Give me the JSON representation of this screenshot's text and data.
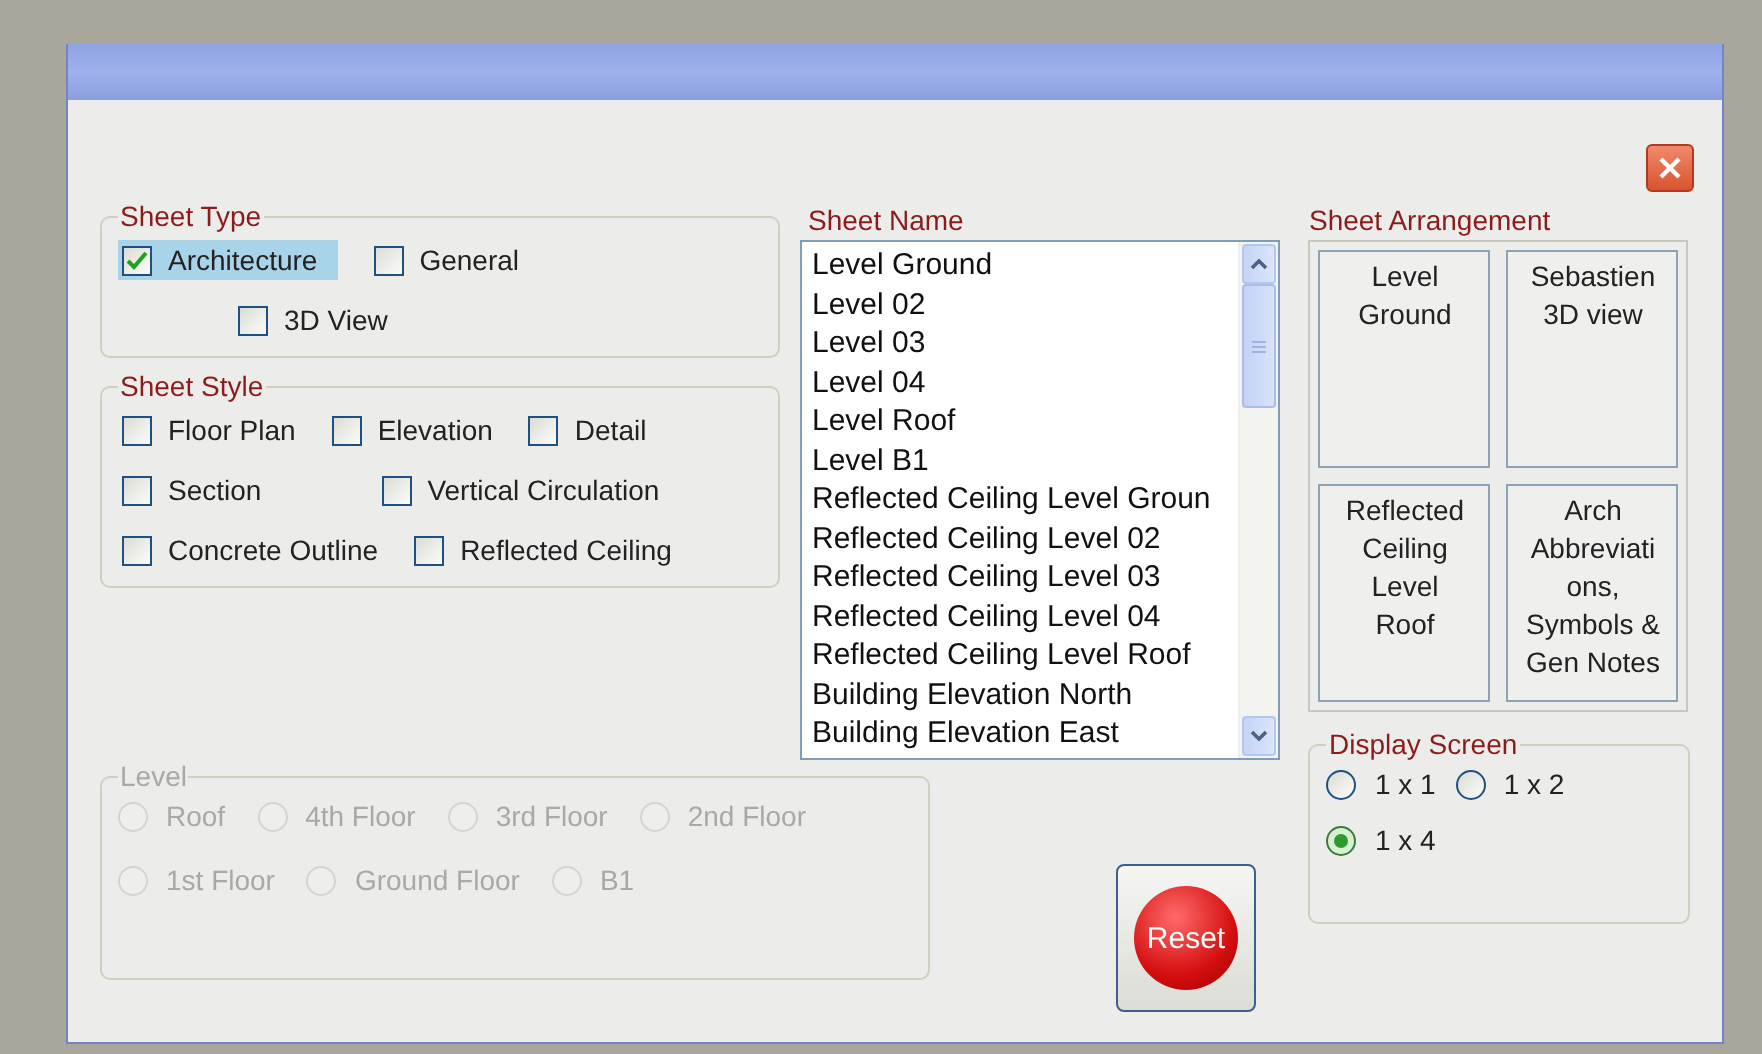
{
  "sheet_type": {
    "title": "Sheet Type",
    "options": [
      {
        "label": "Architecture",
        "checked": true,
        "focused": true
      },
      {
        "label": "General",
        "checked": false,
        "focused": false
      },
      {
        "label": "3D View",
        "checked": false,
        "focused": false
      }
    ]
  },
  "sheet_style": {
    "title": "Sheet Style",
    "options": [
      {
        "label": "Floor Plan",
        "checked": false
      },
      {
        "label": "Elevation",
        "checked": false
      },
      {
        "label": "Detail",
        "checked": false
      },
      {
        "label": "Section",
        "checked": false
      },
      {
        "label": "Vertical Circulation",
        "checked": false
      },
      {
        "label": "Concrete Outline",
        "checked": false
      },
      {
        "label": "Reflected Ceiling",
        "checked": false
      }
    ]
  },
  "sheet_name": {
    "title": "Sheet Name",
    "items": [
      "Level Ground",
      "Level 02",
      "Level 03",
      "Level 04",
      "Level Roof",
      "Level B1",
      "Reflected Ceiling Level Groun",
      "Reflected Ceiling Level 02",
      "Reflected Ceiling Level 03",
      "Reflected Ceiling Level 04",
      "Reflected Ceiling Level Roof",
      "Building Elevation North",
      "Building Elevation East"
    ]
  },
  "level": {
    "title": "Level",
    "disabled": true,
    "options": [
      {
        "label": "Roof",
        "selected": false
      },
      {
        "label": "4th Floor",
        "selected": false
      },
      {
        "label": "3rd Floor",
        "selected": false
      },
      {
        "label": "2nd Floor",
        "selected": false
      },
      {
        "label": "1st Floor",
        "selected": false
      },
      {
        "label": "Ground Floor",
        "selected": false
      },
      {
        "label": "B1",
        "selected": false
      }
    ]
  },
  "reset_button": "Reset",
  "sheet_arrangement": {
    "title": "Sheet Arrangement",
    "cells": [
      {
        "lines": [
          "Level",
          "Ground"
        ]
      },
      {
        "lines": [
          "Sebastien",
          "3D view"
        ]
      },
      {
        "lines": [
          "Reflected",
          "Ceiling",
          "Level",
          "Roof"
        ]
      },
      {
        "lines": [
          "Arch",
          "Abbreviati",
          "ons,",
          "Symbols &",
          "Gen Notes"
        ]
      }
    ]
  },
  "display_screen": {
    "title": "Display Screen",
    "options": [
      {
        "label": "1 x 1",
        "selected": false
      },
      {
        "label": "1 x 2",
        "selected": false
      },
      {
        "label": "1 x 4",
        "selected": true
      }
    ]
  }
}
